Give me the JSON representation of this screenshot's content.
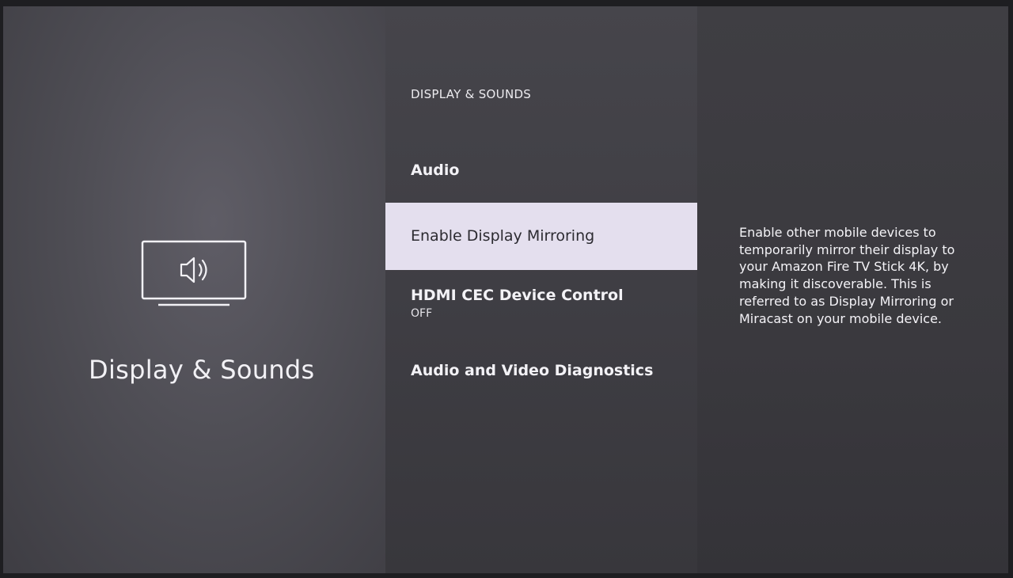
{
  "left": {
    "icon": "tv-speaker-icon",
    "title": "Display & Sounds"
  },
  "middle": {
    "section_header": "DISPLAY & SOUNDS",
    "items": [
      {
        "label": "Audio",
        "sub": ""
      },
      {
        "label": "Enable Display Mirroring",
        "sub": "",
        "selected": true
      },
      {
        "label": "HDMI CEC Device Control",
        "sub": "OFF"
      },
      {
        "label": "Audio and Video Diagnostics",
        "sub": ""
      }
    ]
  },
  "right": {
    "description": "Enable other mobile devices to temporarily mirror their display to your Amazon Fire TV Stick 4K, by making it discoverable. This is referred to as Display Mirroring or Miracast on your mobile device."
  },
  "colors": {
    "selected_bg": "#e4dfee",
    "text": "#f3f2f6",
    "selected_text": "#2c2b31"
  }
}
